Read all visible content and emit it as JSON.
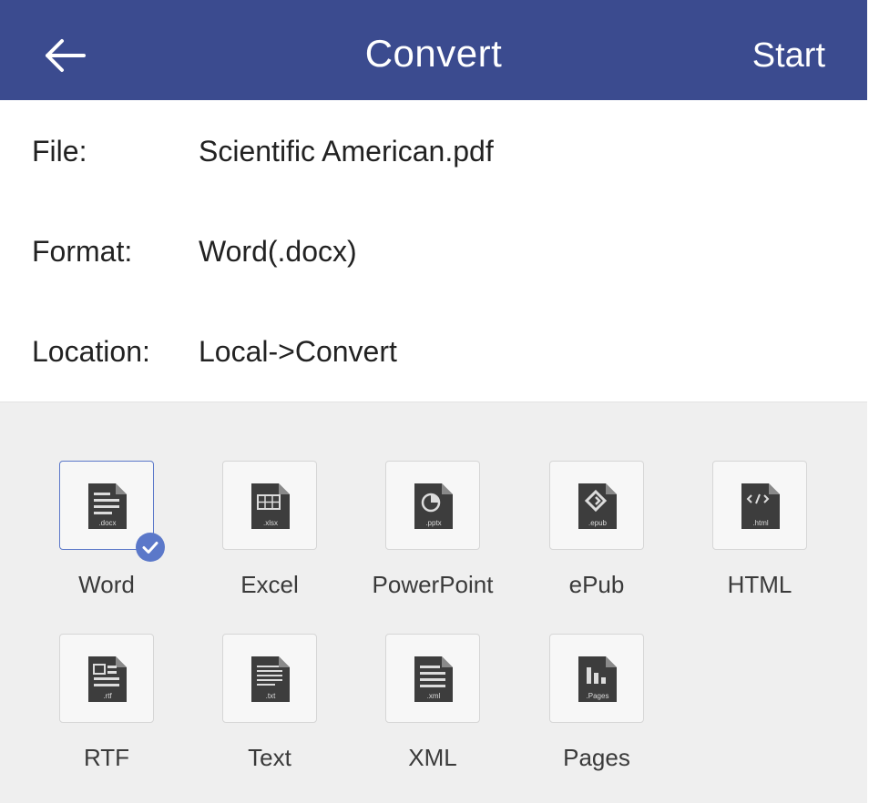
{
  "header": {
    "title": "Convert",
    "start_label": "Start",
    "back_icon": "arrow-left-icon",
    "background_color": "#3b4b8f"
  },
  "rows": [
    {
      "label": "File:",
      "value": "Scientific American.pdf"
    },
    {
      "label": "Format:",
      "value": "Word(.docx)"
    },
    {
      "label": "Location:",
      "value": "Local->Convert"
    }
  ],
  "formats": [
    {
      "label": "Word",
      "ext": ".docx",
      "icon": "word-doc-icon",
      "selected": true
    },
    {
      "label": "Excel",
      "ext": ".xlsx",
      "icon": "excel-sheet-icon",
      "selected": false
    },
    {
      "label": "PowerPoint",
      "ext": ".pptx",
      "icon": "powerpoint-slide-icon",
      "selected": false
    },
    {
      "label": "ePub",
      "ext": ".epub",
      "icon": "epub-book-icon",
      "selected": false
    },
    {
      "label": "HTML",
      "ext": ".html",
      "icon": "html-code-icon",
      "selected": false
    },
    {
      "label": "RTF",
      "ext": ".rtf",
      "icon": "rtf-doc-icon",
      "selected": false
    },
    {
      "label": "Text",
      "ext": ".txt",
      "icon": "text-doc-icon",
      "selected": false
    },
    {
      "label": "XML",
      "ext": ".xml",
      "icon": "xml-doc-icon",
      "selected": false
    },
    {
      "label": "Pages",
      "ext": ".Pages",
      "icon": "pages-doc-icon",
      "selected": false
    }
  ],
  "accent_color": "#5b78c9",
  "selected_badge_icon": "checkmark-icon"
}
